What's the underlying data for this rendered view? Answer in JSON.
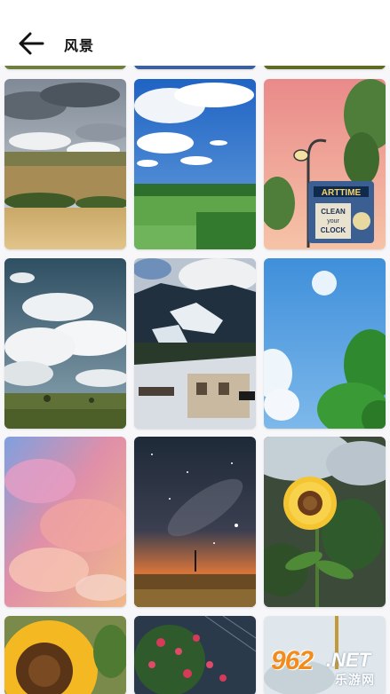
{
  "header": {
    "back_icon": "arrow-left-icon",
    "title": "风景"
  },
  "wallpapers": [
    {
      "name": "top-left-partial",
      "desc": "grass"
    },
    {
      "name": "top-middle-partial",
      "desc": "sky"
    },
    {
      "name": "top-right-partial",
      "desc": "grass"
    },
    {
      "name": "wheat-field-clouds"
    },
    {
      "name": "blue-sky-meadow"
    },
    {
      "name": "street-lamp-sign"
    },
    {
      "name": "cumulus-clouds-field"
    },
    {
      "name": "snowy-mountain-village"
    },
    {
      "name": "blue-sky-tree"
    },
    {
      "name": "pink-sunset-clouds"
    },
    {
      "name": "milky-way-dusk"
    },
    {
      "name": "sunflower-bloom"
    },
    {
      "name": "sunflower-closeup"
    },
    {
      "name": "red-flowers"
    },
    {
      "name": "pale-sky-bottom"
    }
  ],
  "sign": {
    "line1": "ARTTIME",
    "line2": "CLEAN",
    "line3": "your",
    "line4": "CLOCK"
  },
  "watermark": {
    "num": "962",
    "net": ".NET",
    "cn": "乐游网"
  }
}
